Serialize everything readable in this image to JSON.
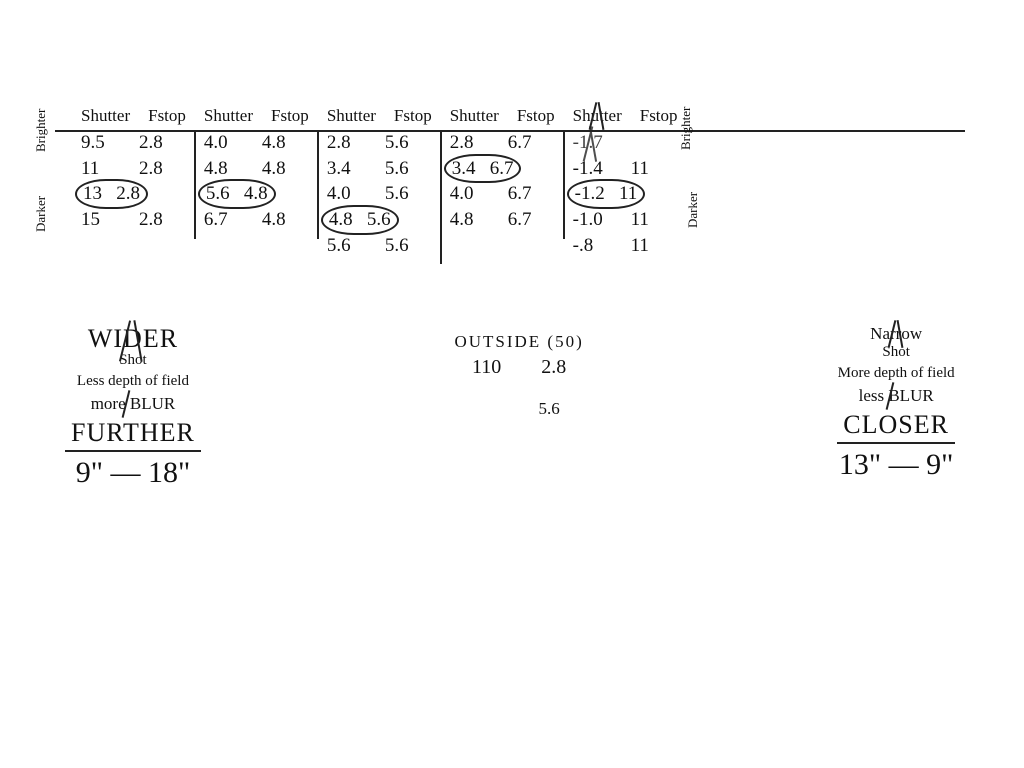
{
  "headers": {
    "shutter": "Shutter",
    "fstop": "Fstop"
  },
  "side_labels": {
    "brighter": "Brighter",
    "darker": "Darker"
  },
  "tables": [
    {
      "rows": [
        {
          "s": "9.5",
          "f": "2.8",
          "c": false
        },
        {
          "s": "11",
          "f": "2.8",
          "c": false
        },
        {
          "s": "13",
          "f": "2.8",
          "c": true
        },
        {
          "s": "15",
          "f": "2.8",
          "c": false
        }
      ]
    },
    {
      "rows": [
        {
          "s": "4.0",
          "f": "4.8",
          "c": false
        },
        {
          "s": "4.8",
          "f": "4.8",
          "c": false
        },
        {
          "s": "5.6",
          "f": "4.8",
          "c": true
        },
        {
          "s": "6.7",
          "f": "4.8",
          "c": false
        }
      ]
    },
    {
      "rows": [
        {
          "s": "2.8",
          "f": "5.6",
          "c": false
        },
        {
          "s": "3.4",
          "f": "5.6",
          "c": false
        },
        {
          "s": "4.0",
          "f": "5.6",
          "c": false
        },
        {
          "s": "4.8",
          "f": "5.6",
          "c": true
        },
        {
          "s": "5.6",
          "f": "5.6",
          "c": false
        }
      ]
    },
    {
      "rows": [
        {
          "s": "2.8",
          "f": "6.7",
          "c": false
        },
        {
          "s": "3.4",
          "f": "6.7",
          "c": true
        },
        {
          "s": "4.0",
          "f": "6.7",
          "c": false
        },
        {
          "s": "4.8",
          "f": "6.7",
          "c": false
        }
      ]
    },
    {
      "strike_first": "-1.7",
      "rows": [
        {
          "s": "-1.4",
          "f": "11",
          "c": false
        },
        {
          "s": "-1.2",
          "f": "11",
          "c": true
        },
        {
          "s": "-1.0",
          "f": "11",
          "c": false
        },
        {
          "s": "-.8",
          "f": "11",
          "c": false
        }
      ]
    }
  ],
  "left_note": {
    "l1": "WIDER",
    "l1b": "Shot",
    "l2": "Less depth of field",
    "l3": "more BLUR",
    "l4": "FURTHER",
    "l5": "9\" — 18\""
  },
  "center_note": {
    "l1": "OUTSIDE (50)",
    "pair_s": "110",
    "pair_f": "2.8",
    "l3": "5.6"
  },
  "right_note": {
    "l1": "Narrow",
    "l1b": "Shot",
    "l2": "More depth of field",
    "l3": "less BLUR",
    "l4": "CLOSER",
    "l5": "13\" — 9\""
  }
}
